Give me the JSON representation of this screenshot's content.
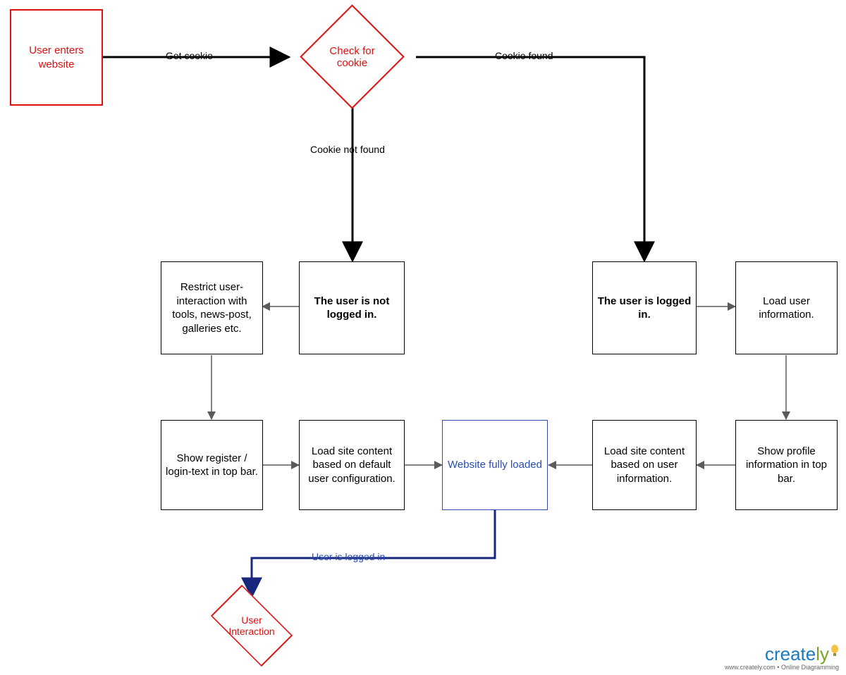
{
  "nodes": {
    "start": "User enters website",
    "check_cookie": "Check for  cookie",
    "not_logged_in": "The user is not logged in.",
    "logged_in": "The user is logged in.",
    "restrict": "Restrict user-interaction with tools, news-post, galleries etc.",
    "load_user_info": "Load user information.",
    "show_register": "Show register / login-text in top bar.",
    "load_default": "Load site content based on default user configuration.",
    "fully_loaded": "Website fully loaded",
    "load_user_content": "Load site content based on user information.",
    "show_profile": "Show profile information in top bar.",
    "user_interaction": "User Interaction"
  },
  "edges": {
    "get_cookie": "Get cookie",
    "cookie_found": "Cookie found",
    "cookie_not_found": "Cookie not found",
    "user_is_logged_in": "User is logged in"
  },
  "watermark": {
    "brand_prefix": "create",
    "brand_suffix": "ly",
    "tagline": "www.creately.com • Online Diagramming"
  },
  "colors": {
    "red": "#d11",
    "blue_box": "#2a4db3",
    "edge_heavy": "#000",
    "edge_light": "#5b5b5b",
    "edge_blue": "#17277e"
  }
}
